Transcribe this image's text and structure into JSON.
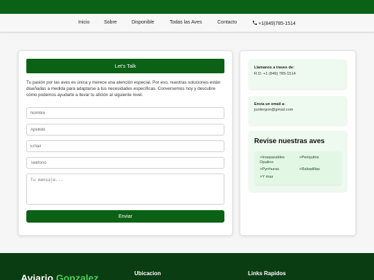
{
  "nav": {
    "items": [
      "Inicio",
      "Sobre",
      "Disponible",
      "Todas las Aves",
      "Contacto"
    ],
    "phone": "+1(849)785-1514"
  },
  "contact_form": {
    "title": "Let's Talk",
    "intro": "Tu pasión por las aves es única y merece una atención especial. Por eso, nuestras soluciones están diseñadas a medida para adaptarse a tus necesidades específicas. Conversemos hoy y descubre cómo podemos ayudarte a llevar tu afición al siguiente nivel.",
    "fields": {
      "name_placeholder": "Nombre",
      "surname_placeholder": "Apellido",
      "email_placeholder": "Email",
      "phone_placeholder": "Telefono",
      "message_placeholder": "Tu mensaje..."
    },
    "submit_label": "Enviar"
  },
  "sidebar": {
    "call": {
      "title": "Llamanos a traves de:",
      "value": "R.D. +1 (849) 785-1514"
    },
    "email": {
      "title": "Envia un email a:",
      "value": "jszdergon@gmail.com"
    },
    "birds": {
      "title": "Revise nuestras aves",
      "links": [
        ">Inseparables Opalino",
        ">Periquitos",
        ">Pyrrhuras",
        ">Rabadillas",
        ">Y mas"
      ]
    }
  },
  "footer": {
    "brand_first": "Aviario",
    "brand_second": "Gonzalez",
    "location_heading": "Ubicacion",
    "links_heading": "Links Rapidos"
  },
  "colors": {
    "brand_green": "#0b6115",
    "footer_green": "#0b3d12",
    "accent_green": "#4ece5a",
    "info_box_bg": "#eefaef"
  },
  "icons": {
    "phone": "phone-icon"
  }
}
